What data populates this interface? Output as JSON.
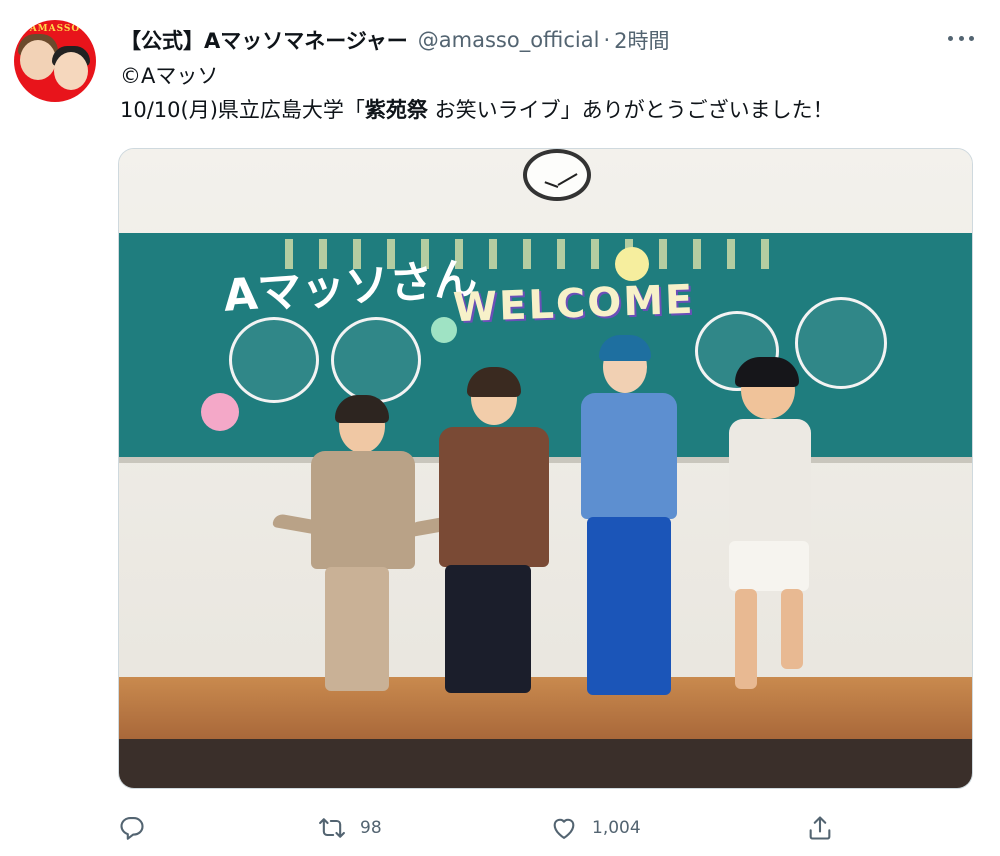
{
  "tweet": {
    "display_name": "【公式】Aマッソマネージャー",
    "handle": "@amasso_official",
    "separator": "·",
    "time": "2時間",
    "line1": "©Aマッソ",
    "line2_prefix": "10/10(月)県立広島大学「",
    "line2_bold": "紫苑祭",
    "line2_suffix": " お笑いライブ」ありがとうございました！"
  },
  "avatar": {
    "logo_text": "AMASSO"
  },
  "photo": {
    "board_text_welcome": "WELCOME",
    "board_text_name": "Aマッソさん"
  },
  "actions": {
    "reply_icon": "reply-icon",
    "retweet_icon": "retweet-icon",
    "retweet_count": "98",
    "like_icon": "heart-icon",
    "like_count": "1,004",
    "share_icon": "share-icon"
  },
  "colors": {
    "text_primary": "#0f1419",
    "text_secondary": "#536471",
    "avatar_bg": "#e8141b",
    "board": "#1f7d7e"
  }
}
